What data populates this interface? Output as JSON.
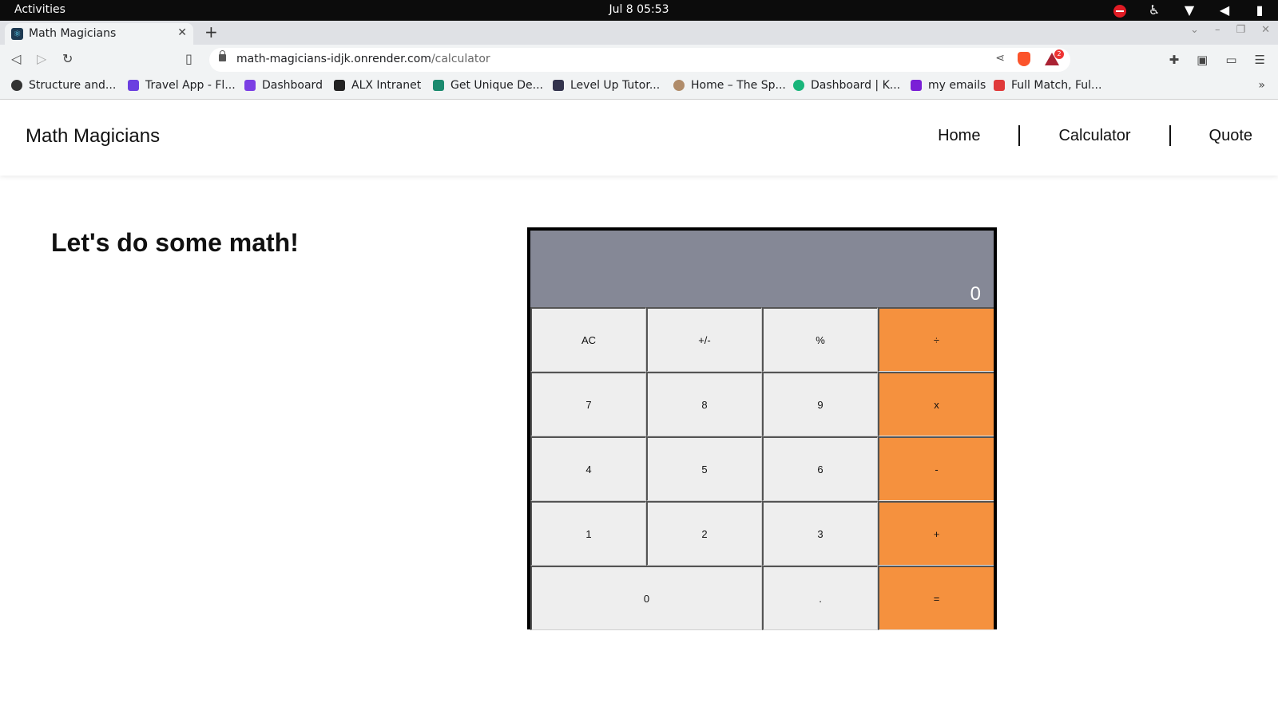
{
  "system_bar": {
    "activities": "Activities",
    "clock": "Jul 8  05:53"
  },
  "browser": {
    "tab_title": "Math Magicians",
    "url_host": "math-magicians-idjk.onrender.com",
    "url_path": "/calculator",
    "rewards_badge": "2",
    "bookmarks": [
      {
        "label": "Structure and...",
        "color": "#333333"
      },
      {
        "label": "Travel App - Fl...",
        "color": "#6b3fe0"
      },
      {
        "label": "Dashboard",
        "color": "#7b3fe4"
      },
      {
        "label": "ALX Intranet",
        "color": "#222222"
      },
      {
        "label": "Get Unique De...",
        "color": "#1a8a6e"
      },
      {
        "label": "Level Up Tutor...",
        "color": "#33334d"
      },
      {
        "label": "Home – The Sp...",
        "color": "#b08c6a"
      },
      {
        "label": "Dashboard | K...",
        "color": "#18b57a"
      },
      {
        "label": "my emails",
        "color": "#7a1fd6"
      },
      {
        "label": "Full Match, Ful...",
        "color": "#e03a3a"
      }
    ]
  },
  "site": {
    "logo": "Math Magicians",
    "nav": {
      "home": "Home",
      "calculator": "Calculator",
      "quote": "Quote"
    },
    "heading": "Let's do some math!"
  },
  "calculator": {
    "display": "0",
    "keys": {
      "ac": "AC",
      "sign": "+/-",
      "percent": "%",
      "divide": "÷",
      "k7": "7",
      "k8": "8",
      "k9": "9",
      "multiply": "x",
      "k4": "4",
      "k5": "5",
      "k6": "6",
      "subtract": "-",
      "k1": "1",
      "k2": "2",
      "k3": "3",
      "add": "+",
      "k0": "0",
      "decimal": ".",
      "equals": "="
    },
    "colors": {
      "display_bg": "#858896",
      "operator_bg": "#f5913e",
      "key_bg": "#eeeeee"
    }
  }
}
